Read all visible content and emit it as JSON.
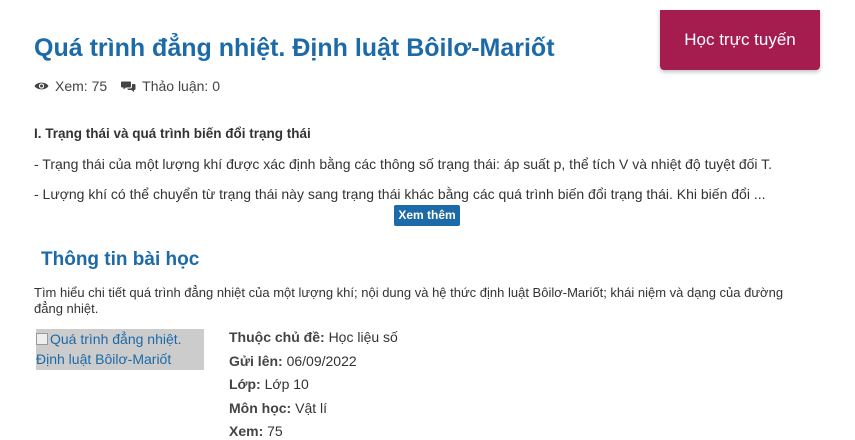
{
  "header": {
    "title": "Quá trình đẳng nhiệt. Định luật Bôilơ-Mariốt",
    "online_button": "Học trực tuyến"
  },
  "meta": {
    "views_label": "Xem: 75",
    "discussion_label": "Thảo luận: 0",
    "views_icon": "eye-icon",
    "discussion_icon": "comments-icon"
  },
  "content": {
    "heading": "I. Trạng thái và quá trình biến đổi trạng thái",
    "paragraph_1": "- Trạng thái của một lượng khí được xác định bằng các thông số trạng thái: áp suất p, thể tích V và nhiệt độ tuyệt đối T.",
    "paragraph_2": "- Lượng khí có thể chuyển từ trạng thái này sang trạng thái khác bằng các quá trình biến đổi trạng thái. Khi biến đổi ...",
    "more_button": "Xem thêm"
  },
  "lesson_info": {
    "title": "Thông tin bài học",
    "description": "Tìm hiểu chi tiết quá trình đẳng nhiệt của một lượng khí; nội dung và hệ thức định luật Bôilơ-Mariốt; khái niệm và dạng của đường đẳng nhiệt.",
    "image_alt": "Quá trình đẳng nhiệt. Định luật Bôilơ-Mariốt",
    "rows": [
      {
        "key": "Thuộc chủ đề:",
        "value": "Học liệu số"
      },
      {
        "key": "Gửi lên:",
        "value": "06/09/2022"
      },
      {
        "key": "Lớp:",
        "value": "Lớp 10"
      },
      {
        "key": "Môn học:",
        "value": "Vật lí"
      },
      {
        "key": "Xem:",
        "value": "75"
      }
    ]
  },
  "colors": {
    "accent_blue": "#1c6aa8",
    "online_button_bg": "#a51d4f"
  }
}
